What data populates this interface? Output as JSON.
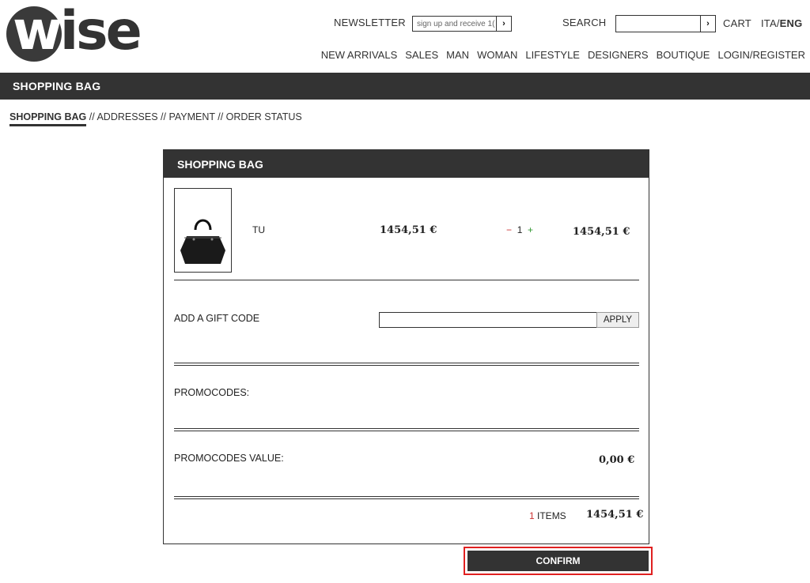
{
  "logo": {
    "first": "w",
    "rest": "ise"
  },
  "header": {
    "newsletter_label": "NEWSLETTER",
    "newsletter_placeholder": "sign up and receive 1(",
    "search_label": "SEARCH",
    "cart_label": "CART",
    "lang_ita": "ITA",
    "lang_sep": "/",
    "lang_eng": "ENG",
    "go_glyph": "›"
  },
  "nav": [
    "NEW ARRIVALS",
    "SALES",
    "MAN",
    "WOMAN",
    "LIFESTYLE",
    "DESIGNERS",
    "BOUTIQUE",
    "LOGIN/REGISTER"
  ],
  "page_bar_title": "SHOPPING BAG",
  "steps": {
    "active": "SHOPPING BAG",
    "rest": " // ADDRESSES // PAYMENT // ORDER STATUS"
  },
  "bag": {
    "title": "SHOPPING BAG",
    "item": {
      "size": "TU",
      "unit_price": "1454,51 €",
      "qty_minus": "−",
      "qty": "1",
      "qty_plus": "+",
      "total": "1454,51 €"
    },
    "gift_label": "ADD A GIFT CODE",
    "apply_label": "APPLY",
    "promo_label": "PROMOCODES:",
    "promo_value_label": "PROMOCODES VALUE:",
    "promo_value": "0,00 €",
    "items_count": "1",
    "items_label": " ITEMS",
    "grand_total": "1454,51 €"
  },
  "confirm_label": "CONFIRM",
  "colors": {
    "dark": "#333333",
    "highlight": "#e02020",
    "minus": "#cc3333",
    "plus": "#339933"
  }
}
